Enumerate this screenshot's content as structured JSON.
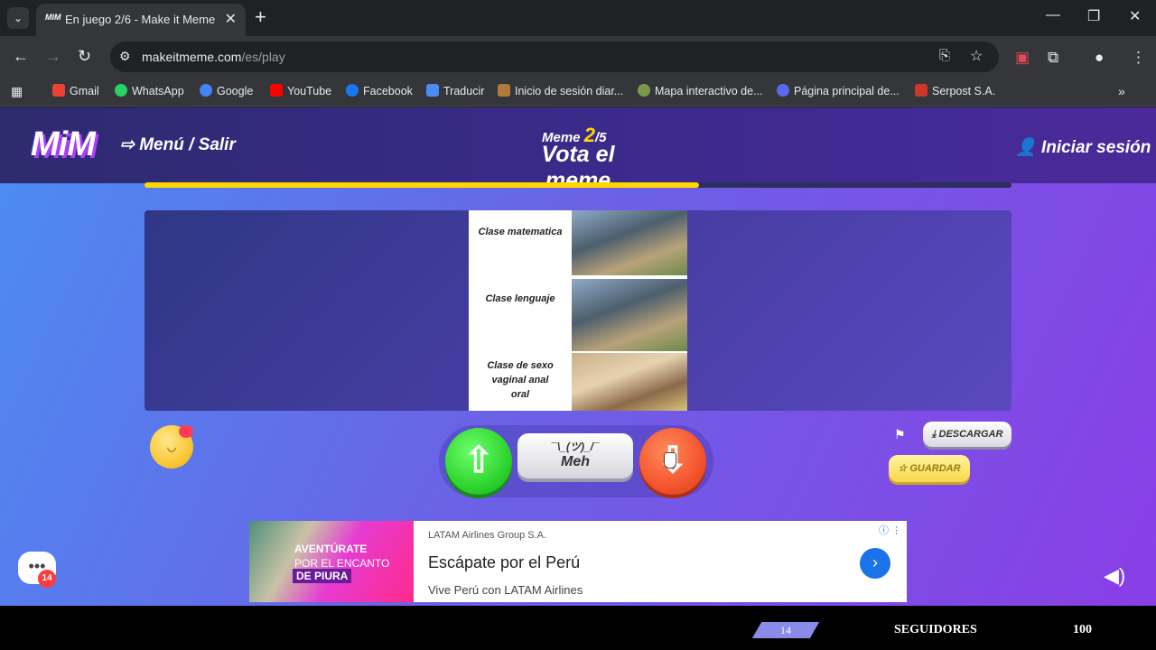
{
  "browser": {
    "tab_title": "En juego 2/6 - Make it Meme",
    "tab_favicon_text": "MIM",
    "url_host": "makeitmeme.com",
    "url_path": "/es/play",
    "bookmarks": [
      {
        "label": "Gmail",
        "color": "#ea4335"
      },
      {
        "label": "WhatsApp",
        "color": "#25d366"
      },
      {
        "label": "Google",
        "color": "#4285f4"
      },
      {
        "label": "YouTube",
        "color": "#ff0000"
      },
      {
        "label": "Facebook",
        "color": "#1877f2"
      },
      {
        "label": "Traducir",
        "color": "#4c8bf5"
      },
      {
        "label": "Inicio de sesión diar...",
        "color": "#b07a3a"
      },
      {
        "label": "Mapa interactivo de...",
        "color": "#7a9a4a"
      },
      {
        "label": "Página principal de...",
        "color": "#5a6af0"
      },
      {
        "label": "Serpost S.A.",
        "color": "#d0352a"
      }
    ]
  },
  "header": {
    "logo": "MiM",
    "menu_label": "Menú / Salir",
    "meme_prefix": "Meme",
    "meme_current": "2",
    "meme_total": "/5",
    "title": "Vota el meme",
    "login_label": "Iniciar sesión"
  },
  "progress": {
    "fraction": 0.64
  },
  "meme": {
    "rows": [
      {
        "label": "Clase matematica"
      },
      {
        "label": "Clase lenguaje"
      },
      {
        "label": "Clase de sexo vaginal anal oral"
      }
    ]
  },
  "vote": {
    "meh_kaomoji": "¯\\_(ツ)_/¯",
    "meh_label": "Meh"
  },
  "actions": {
    "download_label": "DESCARGAR",
    "save_label": "GUARDAR"
  },
  "ad": {
    "image_line1": "AVENTÚRATE",
    "image_line2": "POR EL ENCANTO",
    "image_line3": "DE PIURA",
    "company": "LATAM Airlines Group S.A.",
    "headline": "Escápate por el Perú",
    "subline": "Vive Perú con LATAM Airlines"
  },
  "chat": {
    "badge": "14"
  },
  "bottom": {
    "number": "14",
    "label": "SEGUIDORES",
    "count": "100"
  },
  "colors": {
    "accent_yellow": "#ffd600",
    "up_green": "#2fd52f",
    "down_orange": "#f4552d"
  }
}
